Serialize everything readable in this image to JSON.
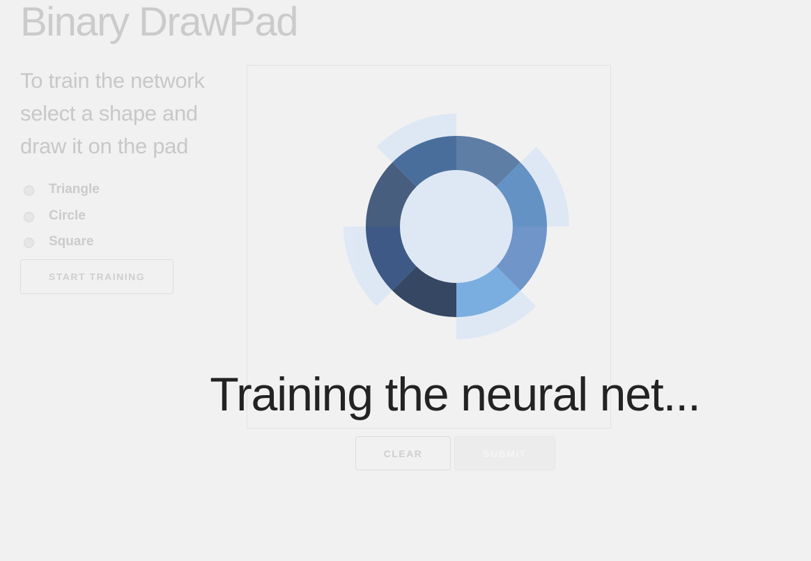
{
  "app": {
    "title": "Binary DrawPad"
  },
  "instructions": {
    "lines": [
      "To train the network",
      "select a shape and",
      "draw it on the pad"
    ]
  },
  "shape_options": [
    {
      "label": "Triangle",
      "selected": false
    },
    {
      "label": "Circle",
      "selected": false
    },
    {
      "label": "Square",
      "selected": false
    }
  ],
  "buttons": {
    "start_training": "START TRAINING",
    "clear": "CLEAR",
    "submit": "SUBMIT"
  },
  "overlay": {
    "message": "Training the neural net...",
    "spinner_colors": {
      "ring_dark": "#3a4f6e",
      "ring_mid": "#4a6b98",
      "ring_light": "#7aaee0",
      "petals": "#dde8f5"
    }
  }
}
